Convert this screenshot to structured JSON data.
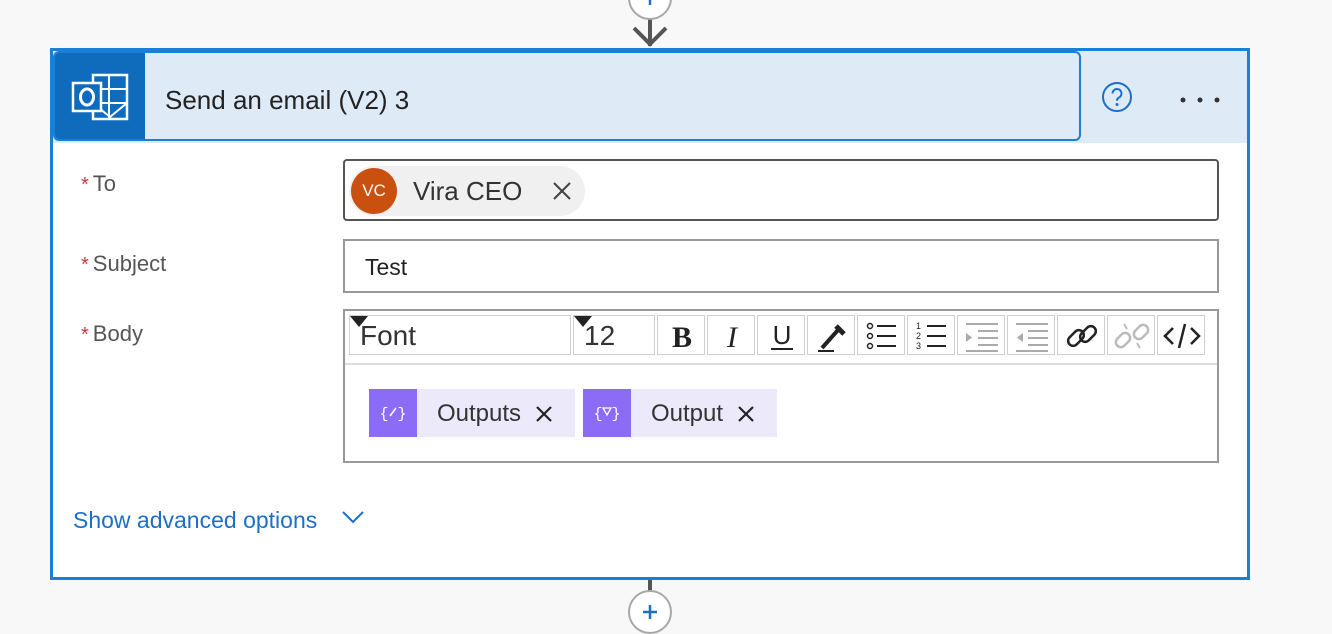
{
  "action": {
    "title": "Send an email (V2) 3",
    "icon": "outlook-icon",
    "help_icon": "help-icon",
    "more_icon": "more-options-icon"
  },
  "fields": {
    "to": {
      "label": "To",
      "required_mark": "*",
      "recipient": {
        "initials": "VC",
        "name": "Vira CEO",
        "avatar_color": "#ca5010"
      }
    },
    "subject": {
      "label": "Subject",
      "required_mark": "*",
      "value": "Test"
    },
    "body": {
      "label": "Body",
      "required_mark": "*",
      "toolbar": {
        "font": "Font",
        "size": "12",
        "buttons": [
          "bold-icon",
          "italic-icon",
          "underline-icon",
          "font-color-icon",
          "bullet-list-icon",
          "numbered-list-icon",
          "indent-decrease-icon",
          "indent-increase-icon",
          "link-icon",
          "unlink-icon",
          "code-view-icon"
        ]
      },
      "tokens": [
        {
          "label": "Outputs",
          "icon": "expression-icon"
        },
        {
          "label": "Output",
          "icon": "filter-expression-icon"
        }
      ]
    }
  },
  "advanced": {
    "label": "Show advanced options"
  },
  "colors": {
    "accent": "#1c7fd6",
    "header_bg": "#dfeaf7",
    "outlook_blue": "#0f6cbd",
    "token_purple": "#8b6cf6",
    "token_bg": "#ece9fb",
    "required_red": "#d13438",
    "link": "#1c6fc8"
  }
}
